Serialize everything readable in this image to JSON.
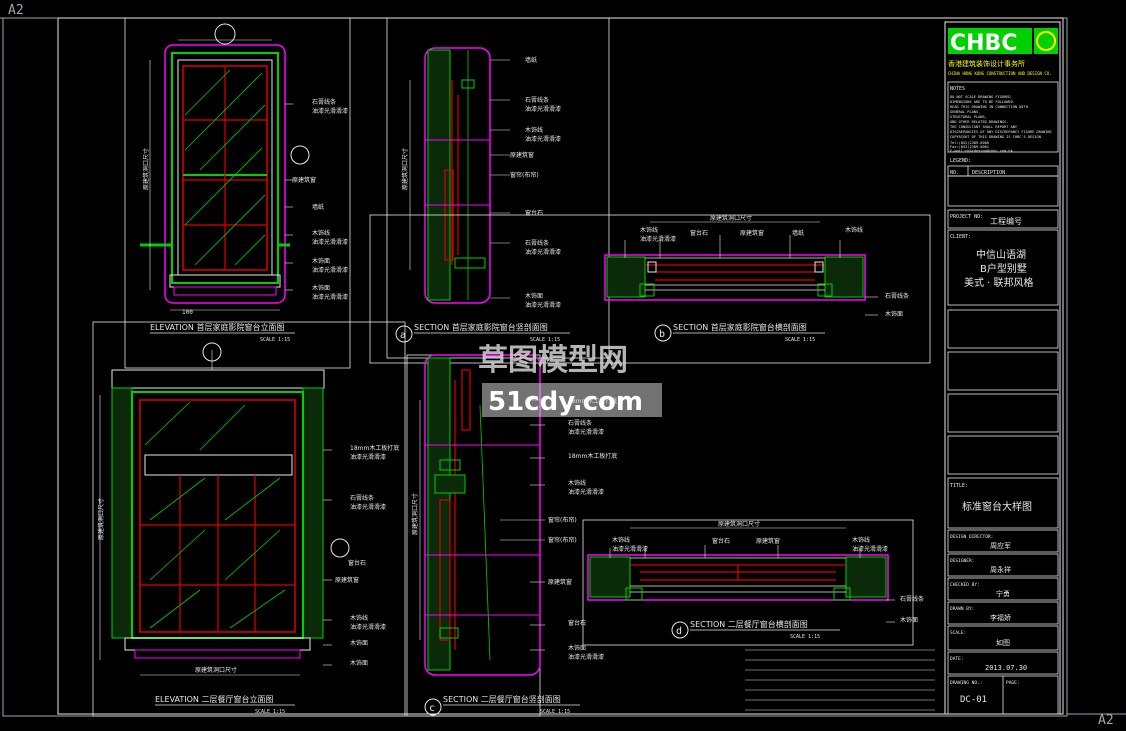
{
  "sheet": {
    "size_tl": "A2",
    "size_br": "A2"
  },
  "watermark": {
    "line1": "草图模型网",
    "line2": "51cdy.com"
  },
  "title_block": {
    "logo": "CHBC",
    "company_cn": "香港建筑装饰设计事务所",
    "company_en": "CHINA HONG KONG CONSTRUCTION AND DESIGN CO.",
    "notes_head": "NOTES",
    "notes_lines": [
      "DO NOT SCALE DRAWING FIGURED",
      "DIMENSIONS ARE TO BE FOLLOWED.",
      "READ THIS DRAWING IN CONNECTION WITH",
      "GENERAL PLANS,",
      "STRUCTURAL PLANS,",
      "AND OTHER RELATED DRAWINGS.",
      "THE CONSULTANT SHALL REPORT ANY",
      "DISCREPANCIES OF ANY DISCREPANCY FIGURE DRAWING",
      "COPYRIGHT OF THIS DRAWING IS CHBC'S DESIGN"
    ],
    "tel": "Tel:(852)2389-0000",
    "fax": "Fax:(852)2389-0001",
    "email": "E-mail:chbcdesign@chbc.com.hk",
    "legend_label": "LEGEND:",
    "no_label": "NO.",
    "desc_label": "DESCRIPTION",
    "project_no_label": "PROJECT NO:",
    "project_no_value": "工程编号",
    "client_label": "CLIENT:",
    "client_lines": [
      "中信山语湖",
      "B户型别墅",
      "美式 · 联邦风格"
    ],
    "title_label": "TITLE:",
    "title_value": "标准窗台大样图",
    "design_director_label": "DESIGN DIRECTOR:",
    "design_director": "周应军",
    "designer_label": "DESIGNER:",
    "designer": "周永祥",
    "checked_label": "CHECKED BY:",
    "checked": "宁勇",
    "drawn_label": "DRAWN BY:",
    "drawn": "李福娇",
    "scale_label": "SCALE:",
    "scale": "如图",
    "date_label": "DATE:",
    "date": "2013.07.30",
    "drawing_no_label": "DRAWING NO.:",
    "drawing_no": "DC-01",
    "page_label": "PAGE:"
  },
  "views": [
    {
      "id": "v1",
      "bubble": "",
      "label": "ELEVATION  首层家庭影院窗台立面图",
      "scale": "SCALE 1:15"
    },
    {
      "id": "v2",
      "bubble": "a",
      "label": "SECTION  首层家庭影院窗台竖剖面图",
      "scale": "SCALE 1:15"
    },
    {
      "id": "v3",
      "bubble": "b",
      "label": "SECTION  首层家庭影院窗台横剖面图",
      "scale": "SCALE 1:15"
    },
    {
      "id": "v4",
      "bubble": "",
      "label": "ELEVATION  二层餐厅窗台立面图",
      "scale": "SCALE 1:15"
    },
    {
      "id": "v5",
      "bubble": "c",
      "label": "SECTION  二层餐厅窗台竖剖面图",
      "scale": "SCALE 1:15"
    },
    {
      "id": "v6",
      "bubble": "d",
      "label": "SECTION  二层餐厅窗台横剖面图",
      "scale": "SCALE 1:15"
    }
  ],
  "notes": {
    "n_gypsum_a": "石膏线条",
    "n_gypsum_b": "油漆光滑滑漆",
    "n_wood_a": "木饰线",
    "n_wood_b": "油漆光滑滑漆",
    "n_frame": "原建筑窗",
    "n_wall": "墙纸",
    "n_sill": "木饰面",
    "n_curtain": "窗帘(布帘)",
    "n_stone": "窗台石",
    "n_marble": "大理石",
    "n_board": "18mm木工板打底",
    "n_cabinet": "木饰面"
  },
  "dims": {
    "width": "原建筑洞口尺寸",
    "height": "原建筑洞口尺寸",
    "d100": "100",
    "d150": "150",
    "d1000": "1000"
  },
  "colors": {
    "background": "#000000",
    "frame": "#00e5e5",
    "green": "#00d000",
    "red": "#e00000",
    "magenta": "#ff00ff",
    "white": "#e8e8e8",
    "yellow": "#ffff00"
  }
}
